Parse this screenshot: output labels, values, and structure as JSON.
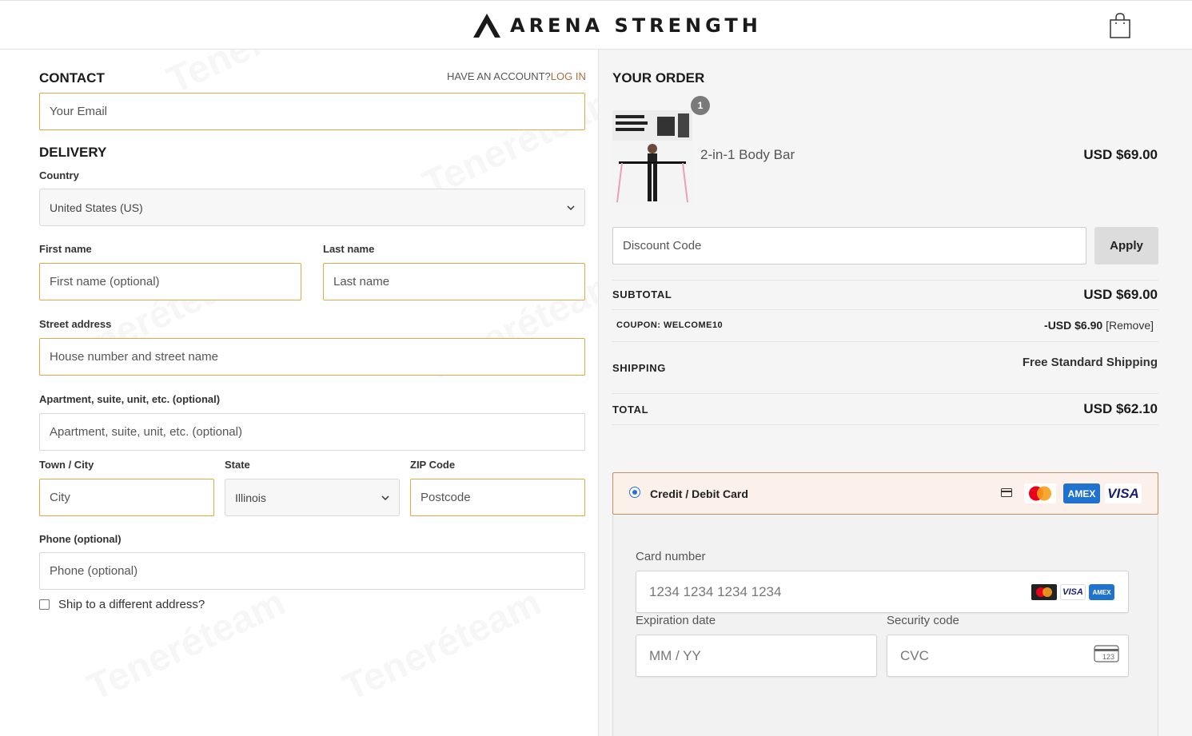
{
  "header": {
    "brand": "ARENA STRENGTH",
    "cart_icon": "shopping-bag-icon"
  },
  "contact": {
    "title": "CONTACT",
    "account_prompt": "HAVE AN ACCOUNT?",
    "login_link": "LOG IN",
    "email_placeholder": "Your Email"
  },
  "delivery": {
    "title": "DELIVERY",
    "country_label": "Country",
    "country_value": "United States (US)",
    "first_name_label": "First name",
    "first_name_placeholder": "First name (optional)",
    "last_name_label": "Last name",
    "last_name_placeholder": "Last name",
    "street_label": "Street address",
    "street_placeholder": "House number and street name",
    "apt_label": "Apartment, suite, unit, etc. (optional)",
    "apt_placeholder": "Apartment, suite, unit, etc. (optional)",
    "city_label": "Town / City",
    "city_placeholder": "City",
    "state_label": "State",
    "state_value": "Illinois",
    "zip_label": "ZIP Code",
    "zip_placeholder": "Postcode",
    "phone_label": "Phone (optional)",
    "phone_placeholder": "Phone (optional)",
    "ship_different_label": "Ship to a different address?"
  },
  "order": {
    "title": "YOUR ORDER",
    "item": {
      "quantity": "1",
      "name": "2-in-1 Body Bar",
      "price": "USD $69.00"
    },
    "discount_placeholder": "Discount Code",
    "apply_label": "Apply",
    "subtotal_label": "SUBTOTAL",
    "subtotal_value": "USD $69.00",
    "coupon_label": "COUPON: WELCOME10",
    "coupon_value": "-USD $6.90",
    "coupon_remove": "[Remove]",
    "shipping_label": "SHIPPING",
    "shipping_value": "Free Standard Shipping",
    "total_label": "TOTAL",
    "total_value": "USD $62.10"
  },
  "payment": {
    "method_label": "Credit / Debit Card",
    "brands": [
      "card-icon",
      "mastercard-icon",
      "amex-icon",
      "visa-icon"
    ],
    "card_number_label": "Card number",
    "card_number_placeholder": "1234 1234 1234 1234",
    "expiry_label": "Expiration date",
    "expiry_placeholder": "MM / YY",
    "cvc_label": "Security code",
    "cvc_placeholder": "CVC",
    "visa_text": "VISA",
    "amex_text": "AMEX",
    "cvc_icon_text": "123"
  },
  "watermark": "Teneréteam",
  "colors": {
    "accent_border": "#e0a84a",
    "link": "#a5703a",
    "payment_selected_bg": "#fbf1ea",
    "visa_blue": "#1a1f71",
    "amex_blue": "#1f72cd"
  }
}
